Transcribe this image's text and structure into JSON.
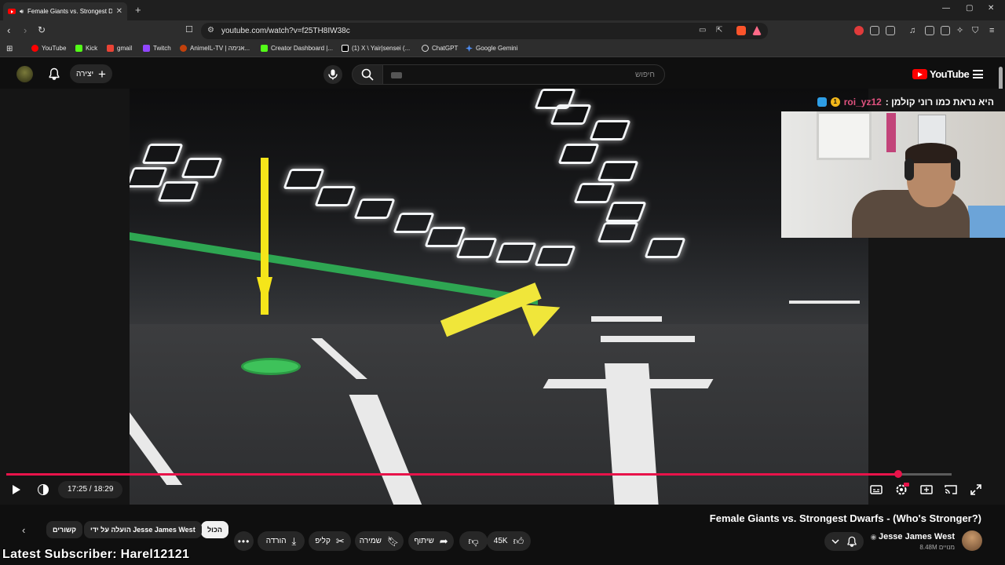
{
  "browser": {
    "tab_title": "Female Giants vs. Strongest D",
    "url": "youtube.com/watch?v=f25TH8IW38c",
    "bookmarks": [
      {
        "label": "YouTube",
        "color": "#ff0000"
      },
      {
        "label": "Kick",
        "color": "#53fc18"
      },
      {
        "label": "gmail",
        "color": "#ea4335"
      },
      {
        "label": "Twitch",
        "color": "#9146ff"
      },
      {
        "label": "AnimeIL-TV | אנימה...",
        "color": "#c2410c"
      },
      {
        "label": "Creator Dashboard |...",
        "color": "#53fc18"
      },
      {
        "label": "(1) X \\ Yair|sensei (...",
        "color": "#ffffff"
      },
      {
        "label": "ChatGPT",
        "color": "#dddddd"
      },
      {
        "label": "Google Gemini",
        "color": "#4f8ff7"
      }
    ]
  },
  "youtube": {
    "create_label": "יצירה",
    "search_placeholder": "חיפוש",
    "logo_text": "YouTube"
  },
  "overlay": {
    "chat_user": "roi_yz12",
    "chat_text": "היא נראת כמו רוני קולמן :",
    "chat_badge": "1",
    "latest_subscriber": "Latest Subscriber: Harel12121"
  },
  "player": {
    "time": "17:25 / 18:29",
    "progress": 0.9435,
    "accent": "#e8134a"
  },
  "video": {
    "title": "Female Giants vs. Strongest Dwarfs - (Who's Stronger?)",
    "channel": "Jesse James West",
    "subscribers": "8.48M מנויים",
    "likes": "45K",
    "share_label": "שיתוף",
    "save_label": "שמירה",
    "clip_label": "קליפ",
    "download_label": "הורדה"
  },
  "chips": {
    "all": "הכול",
    "uploaded_by": "הועלה על ידי Jesse James West",
    "related": "קשורים"
  }
}
